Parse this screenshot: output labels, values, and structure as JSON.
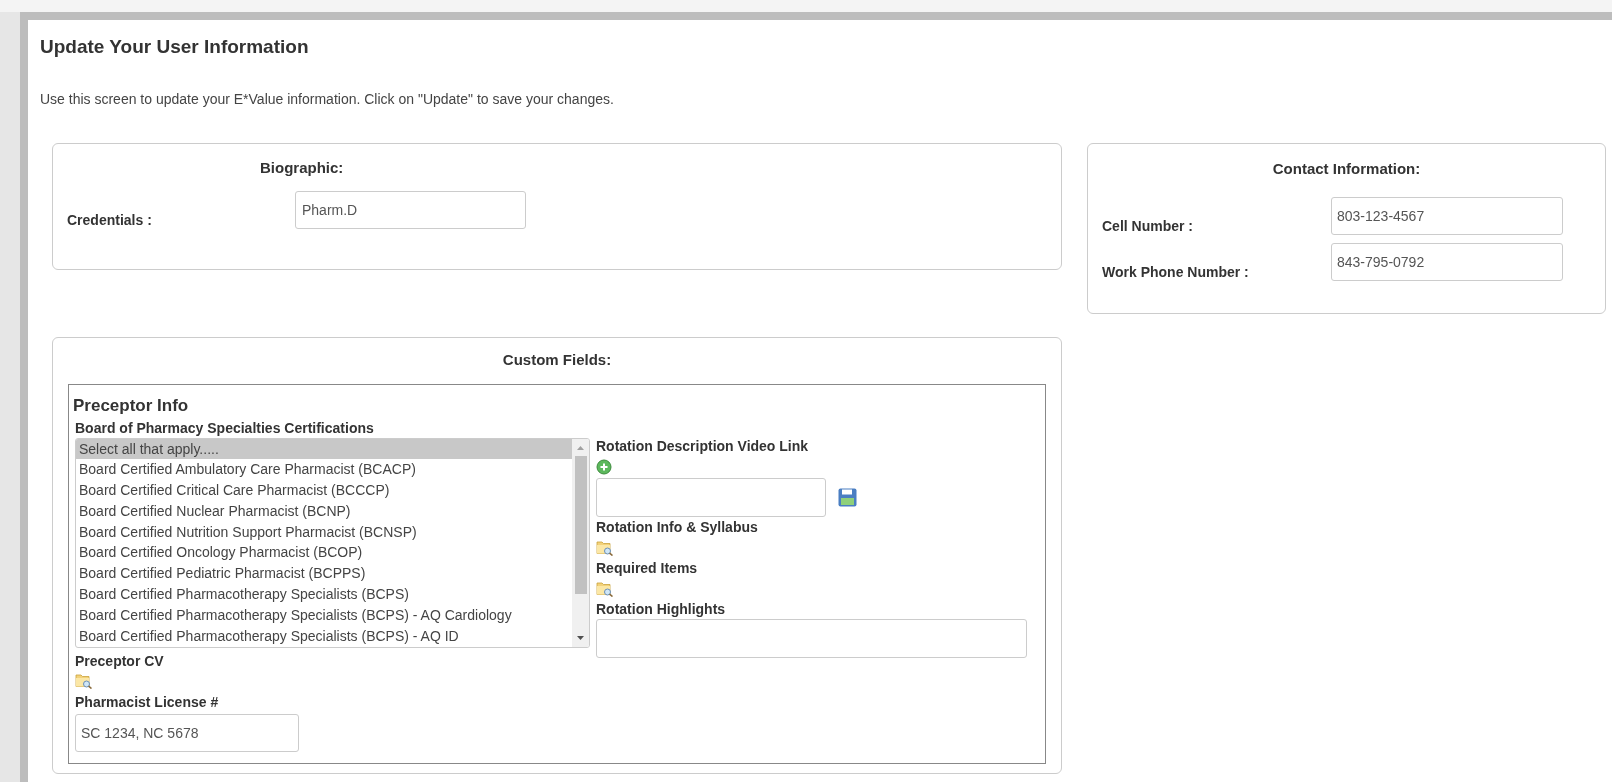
{
  "title": "Update Your User Information",
  "description": "Use this screen to update your E*Value information. Click on \"Update\" to save your changes.",
  "biographic": {
    "heading": "Biographic:",
    "fields": [
      {
        "label": "Credentials :",
        "value": "Pharm.D"
      }
    ]
  },
  "contact": {
    "heading": "Contact Information:",
    "fields": [
      {
        "label": "Cell Number :",
        "value": "803-123-4567"
      },
      {
        "label": "Work Phone Number :",
        "value": "843-795-0792"
      }
    ]
  },
  "custom_fields": {
    "heading": "Custom Fields:",
    "section_title": "Preceptor Info",
    "certifications": {
      "label": "Board of Pharmacy Specialties Certifications",
      "options": [
        {
          "label": "Select all that apply.....",
          "selected": true
        },
        {
          "label": "Board Certified Ambulatory Care Pharmacist (BCACP)",
          "selected": false
        },
        {
          "label": "Board Certified Critical Care Pharmacist (BCCCP)",
          "selected": false
        },
        {
          "label": "Board Certified Nuclear Pharmacist (BCNP)",
          "selected": false
        },
        {
          "label": "Board Certified Nutrition Support Pharmacist (BCNSP)",
          "selected": false
        },
        {
          "label": "Board Certified Oncology Pharmacist (BCOP)",
          "selected": false
        },
        {
          "label": "Board Certified Pediatric Pharmacist (BCPPS)",
          "selected": false
        },
        {
          "label": "Board Certified Pharmacotherapy Specialists (BCPS)",
          "selected": false
        },
        {
          "label": "Board Certified Pharmacotherapy Specialists (BCPS) - AQ Cardiology",
          "selected": false
        },
        {
          "label": "Board Certified Pharmacotherapy Specialists (BCPS) - AQ ID",
          "selected": false
        }
      ]
    },
    "preceptor_cv": {
      "label": "Preceptor CV"
    },
    "license": {
      "label": "Pharmacist License #",
      "value": "SC 1234, NC 5678"
    },
    "video_link": {
      "label": "Rotation Description Video Link"
    },
    "syllabus": {
      "label": "Rotation Info & Syllabus"
    },
    "required_items": {
      "label": "Required Items"
    },
    "highlights": {
      "label": "Rotation Highlights"
    }
  }
}
